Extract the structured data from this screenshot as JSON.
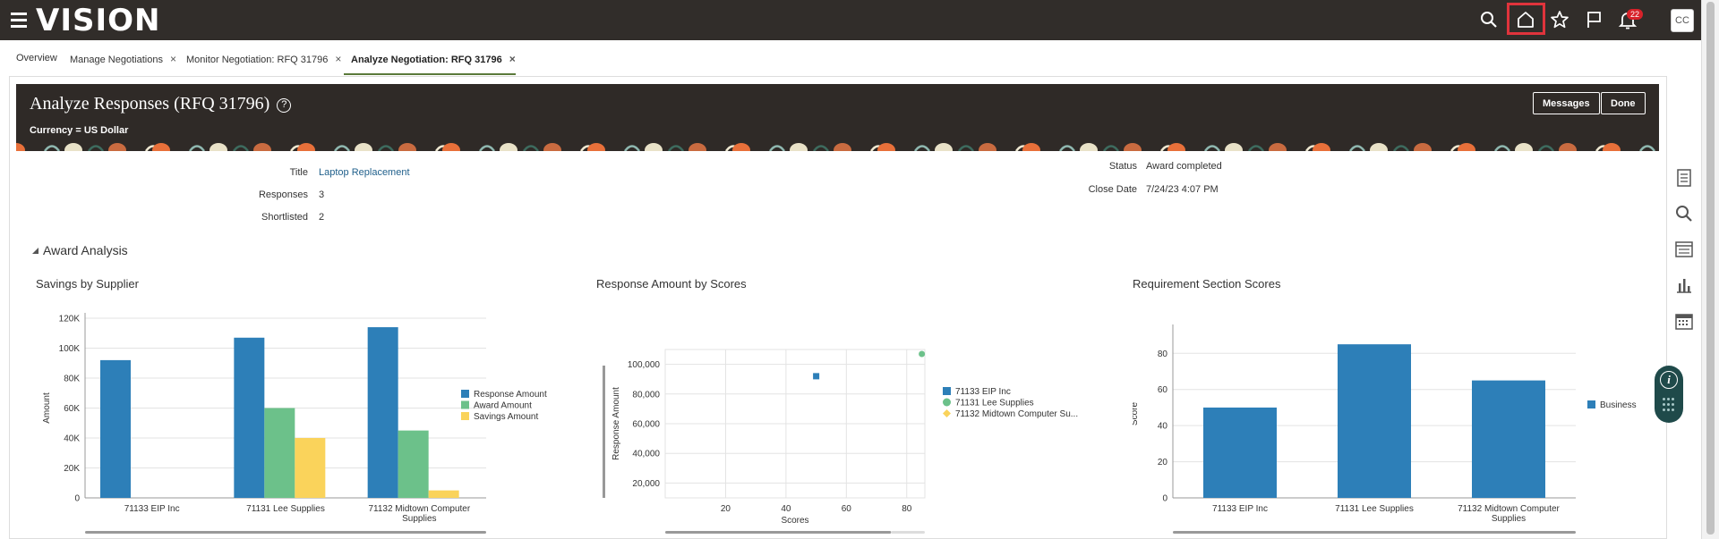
{
  "app": {
    "logo": "VISION",
    "notifications": "22",
    "avatar": "CC"
  },
  "tabs": [
    {
      "label": "Overview",
      "closable": false
    },
    {
      "label": "Manage Negotiations",
      "closable": true
    },
    {
      "label": "Monitor Negotiation: RFQ 31796",
      "closable": true
    },
    {
      "label": "Analyze Negotiation: RFQ 31796",
      "closable": true,
      "active": true
    }
  ],
  "tab_close": "×",
  "header": {
    "title": "Analyze Responses (RFQ 31796)",
    "help": "?",
    "currency": "Currency = US Dollar",
    "messages_btn": "Messages",
    "done_btn": "Done"
  },
  "fields": {
    "title_label": "Title",
    "title_value": "Laptop Replacement",
    "responses_label": "Responses",
    "responses_value": "3",
    "shortlisted_label": "Shortlisted",
    "shortlisted_value": "2",
    "status_label": "Status",
    "status_value": "Award completed",
    "close_label": "Close Date",
    "close_value": "7/24/23 4:07 PM"
  },
  "section": {
    "title": "Award Analysis"
  },
  "colors": {
    "blue": "#2d7fb8",
    "green": "#6cc18a",
    "yellow": "#fad35b",
    "gold": "#fad35b"
  },
  "chart_data": [
    {
      "type": "bar",
      "title": "Savings by Supplier",
      "ylabel": "Amount",
      "xlabel": "",
      "categories": [
        "71133 EIP Inc",
        "71131 Lee Supplies",
        "71132 Midtown Computer Supplies"
      ],
      "category_lines": [
        [
          "71133 EIP Inc"
        ],
        [
          "71131 Lee Supplies"
        ],
        [
          "71132 Midtown Computer",
          "Supplies"
        ]
      ],
      "series": [
        {
          "name": "Response Amount",
          "values": [
            92000,
            107000,
            114000
          ],
          "color": "#2d7fb8"
        },
        {
          "name": "Award Amount",
          "values": [
            0,
            60000,
            45000
          ],
          "color": "#6cc18a"
        },
        {
          "name": "Savings Amount",
          "values": [
            0,
            40000,
            5000
          ],
          "color": "#fad35b"
        }
      ],
      "ylim": [
        0,
        120000
      ],
      "yticks": [
        "0",
        "20K",
        "40K",
        "60K",
        "80K",
        "100K",
        "120K"
      ],
      "legend": "right",
      "grid": true
    },
    {
      "type": "scatter",
      "title": "Response Amount by Scores",
      "xlabel": "Scores",
      "ylabel": "Response Amount",
      "series": [
        {
          "name": "71133 EIP Inc",
          "x": [
            50
          ],
          "y": [
            92000
          ],
          "color": "#2d7fb8",
          "marker": "square"
        },
        {
          "name": "71131 Lee Supplies",
          "x": [
            85
          ],
          "y": [
            107000
          ],
          "color": "#6cc18a",
          "marker": "circle"
        },
        {
          "name": "71132 Midtown Computer Su...",
          "x": [],
          "y": [],
          "color": "#fad35b",
          "marker": "diamond"
        }
      ],
      "xlim": [
        0,
        86
      ],
      "xticks": [
        "20",
        "40",
        "60",
        "80"
      ],
      "ylim": [
        10000,
        110000
      ],
      "yticks": [
        "20,000",
        "40,000",
        "60,000",
        "80,000",
        "100,000"
      ],
      "legend": "right",
      "grid": true
    },
    {
      "type": "bar",
      "title": "Requirement Section Scores",
      "ylabel": "Score",
      "xlabel": "",
      "categories": [
        "71133 EIP Inc",
        "71131 Lee Supplies",
        "71132 Midtown Computer Supplies"
      ],
      "category_lines": [
        [
          "71133 EIP Inc"
        ],
        [
          "71131 Lee Supplies"
        ],
        [
          "71132 Midtown Computer",
          "Supplies"
        ]
      ],
      "series": [
        {
          "name": "Business",
          "values": [
            50,
            85,
            65
          ],
          "color": "#2d7fb8"
        }
      ],
      "ylim": [
        0,
        93
      ],
      "yticks": [
        "0",
        "20",
        "40",
        "60",
        "80"
      ],
      "legend": "right",
      "grid": true
    }
  ]
}
